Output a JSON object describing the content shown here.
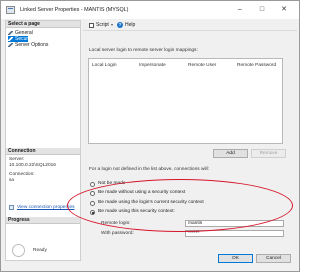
{
  "window": {
    "title": "Linked Server Properties - MANTIS (MYSQL)",
    "controls": {
      "minimize": "–",
      "maximize": "□",
      "close": "✕"
    }
  },
  "sidebar": {
    "select_page_header": "Select a page",
    "pages": [
      {
        "label": "General",
        "icon": "wrench-icon",
        "selected": false
      },
      {
        "label": "Security",
        "icon": "wrench-icon",
        "selected": true
      },
      {
        "label": "Server Options",
        "icon": "wrench-icon",
        "selected": false
      }
    ],
    "connection": {
      "header": "Connection",
      "server_label": "Server:",
      "server_value": "10.100.0.22\\SQL2016",
      "connection_label": "Connection:",
      "connection_value": "sa",
      "view_properties_link": "View connection properties"
    },
    "progress": {
      "header": "Progress",
      "status": "Ready"
    }
  },
  "toolbar": {
    "script_label": "Script",
    "script_dropdown": "▾",
    "help_glyph": "?",
    "help_label": "Help"
  },
  "main": {
    "mapping_label": "Local server login to remote server login mappings:",
    "grid_columns": [
      "Local Login",
      "Impersonate",
      "Remote User",
      "Remote Password"
    ],
    "add_button": "Add",
    "remove_button": "Remove",
    "not_defined_label": "For a login not defined in the list above, connections will:",
    "options": [
      {
        "label": "Not be made",
        "selected": false
      },
      {
        "label": "Be made without using a security context",
        "selected": false
      },
      {
        "label": "Be made using the login's current security context",
        "selected": false
      },
      {
        "label": "Be made using this security context:",
        "selected": true
      }
    ],
    "remote_login_label": "Remote login:",
    "remote_login_value": "mantis",
    "with_password_label": "With password:",
    "with_password_value": "******"
  },
  "footer": {
    "ok_button": "OK",
    "cancel_button": "Cancel"
  },
  "colors": {
    "accent": "#0078d7",
    "highlight_oval": "#d6162a",
    "link": "#1a56b4"
  }
}
